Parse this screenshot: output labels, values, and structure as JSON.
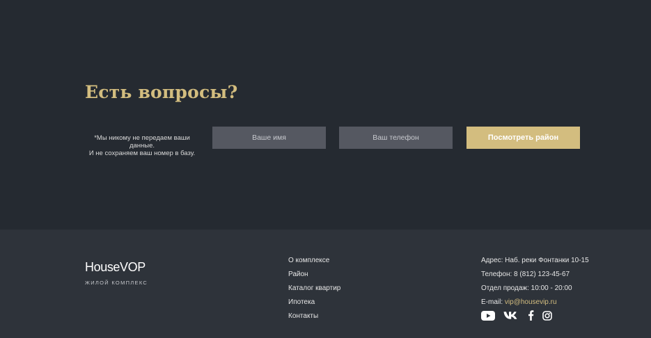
{
  "cta": {
    "title": "Есть вопросы?",
    "disclaimer_line1": "*Мы никому не передаем ваши данные.",
    "disclaimer_line2": "И не сохраняем ваш номер в базу.",
    "name_placeholder": "Ваше имя",
    "phone_placeholder": "Ваш телефон",
    "button_label": "Посмотреть район"
  },
  "footer": {
    "logo": "HouseVOP",
    "logo_subtitle": "ЖИЛОЙ КОМПЛЕКС",
    "nav": [
      {
        "label": "О комплексе"
      },
      {
        "label": "Район"
      },
      {
        "label": "Каталог квартир"
      },
      {
        "label": "Ипотека"
      },
      {
        "label": "Контакты"
      }
    ],
    "address": "Адрес: Наб. реки Фонтанки 10-15",
    "phone": "Телефон: 8 (812) 123-45-67",
    "hours": "Отдел продаж: 10:00 - 20:00",
    "email_label": "E-mail:",
    "email": "vip@housevip.ru",
    "socials": [
      {
        "icon": "youtube-icon"
      },
      {
        "icon": "vk-icon"
      },
      {
        "icon": "facebook-icon"
      },
      {
        "icon": "instagram-icon"
      }
    ]
  },
  "colors": {
    "accent": "#d3bd7f",
    "background": "#252a31",
    "footer_background": "#2e333a",
    "input_background": "#555861"
  }
}
